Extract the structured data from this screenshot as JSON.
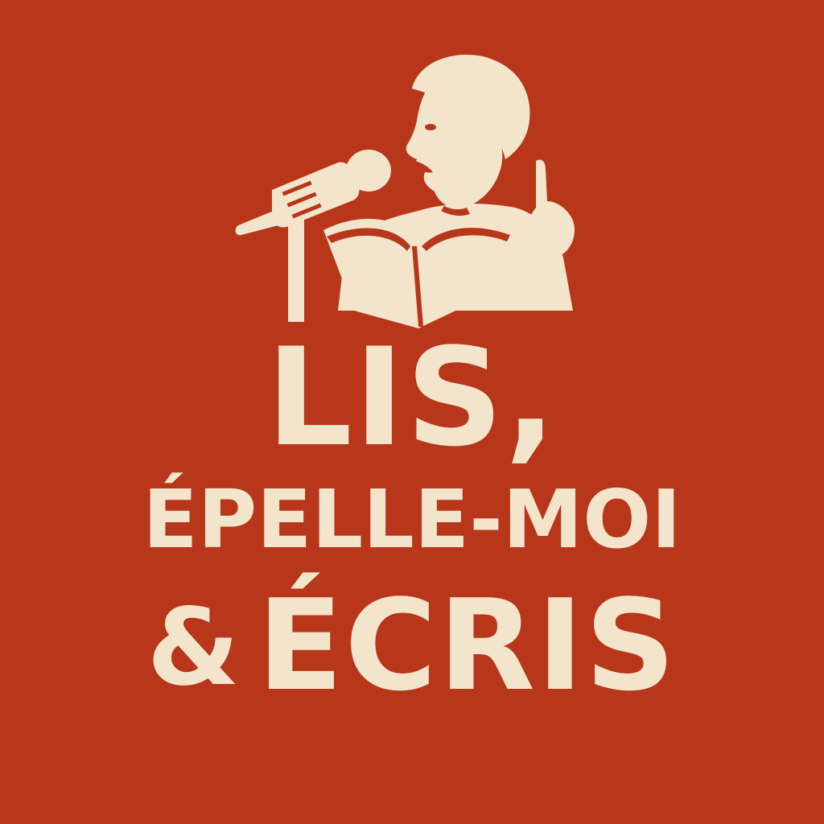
{
  "colors": {
    "background": "#b83619",
    "foreground": "#f3e5cc"
  },
  "illustration": {
    "icon": "speaker-reading-book-at-microphone-icon"
  },
  "title": {
    "line1": "LIS,",
    "line2": "ÉPELLE-MOI",
    "line3_amp": "&",
    "line3_word": "ÉCRIS"
  }
}
